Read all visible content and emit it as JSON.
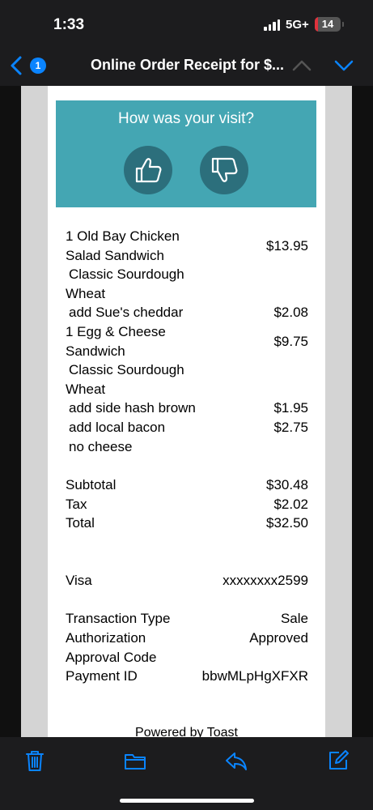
{
  "status": {
    "time": "1:33",
    "network": "5G+",
    "battery": "14",
    "battery_level": 0.14,
    "battery_color": "#e0323c"
  },
  "nav": {
    "back_count": "1",
    "title": "Online Order Receipt for $...",
    "icons": [
      "chevron-left-icon",
      "chevron-up-icon",
      "chevron-down-icon"
    ],
    "accent": "#0a84ff"
  },
  "feedback": {
    "title": "How was your visit?",
    "color": "#44a6b3",
    "icons": [
      "thumbs-up-icon",
      "thumbs-down-icon"
    ]
  },
  "items": [
    {
      "label": "1 Old Bay Chicken",
      "value": ""
    },
    {
      "label": "Salad Sandwich",
      "value": ""
    },
    {
      "label": " Classic Sourdough",
      "value": ""
    },
    {
      "label": "Wheat",
      "value": ""
    },
    {
      "label": " add Sue's cheddar",
      "value": "$2.08"
    },
    {
      "label": "1 Egg & Cheese",
      "value": ""
    },
    {
      "label": "Sandwich",
      "value": ""
    },
    {
      "label": " Classic Sourdough",
      "value": ""
    },
    {
      "label": "Wheat",
      "value": ""
    },
    {
      "label": " add side hash brown",
      "value": "$1.95"
    },
    {
      "label": " add local bacon",
      "value": "$2.75"
    },
    {
      "label": " no cheese",
      "value": ""
    }
  ],
  "item_prices": {
    "old_bay": "$13.95",
    "egg_cheese": "$9.75"
  },
  "totals": {
    "subtotal_label": "Subtotal",
    "subtotal": "$30.48",
    "tax_label": "Tax",
    "tax": "$2.02",
    "total_label": "Total",
    "total": "$32.50"
  },
  "payment": {
    "card_label": "Visa",
    "card_number": "xxxxxxxx2599",
    "transaction_type_label": "Transaction Type",
    "transaction_type": "Sale",
    "authorization_label": "Authorization",
    "authorization": "Approved",
    "approval_code_label": "Approval Code",
    "approval_code": "",
    "payment_id_label": "Payment ID",
    "payment_id": "bbwMLpHgXFXR"
  },
  "footer": {
    "powered_by": "Powered by Toast"
  },
  "toolbar": {
    "icons": [
      "trash-icon",
      "folder-icon",
      "reply-icon",
      "compose-icon"
    ]
  }
}
